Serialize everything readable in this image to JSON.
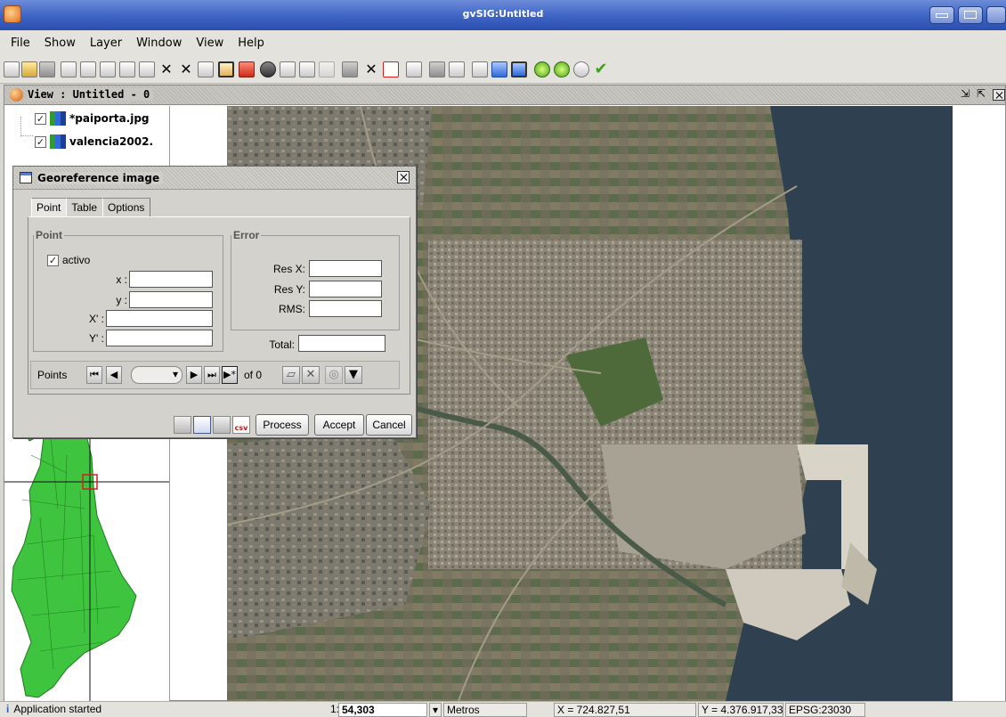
{
  "window": {
    "title": "gvSIG:Untitled"
  },
  "menu": [
    "File",
    "Show",
    "Layer",
    "Window",
    "View",
    "Help"
  ],
  "toolbar": {
    "icons": [
      "new-project-icon",
      "open-project-icon",
      "save-project-icon",
      "add-layer-icon",
      "zoom-in-icon",
      "zoom-out-icon",
      "zoom-previous-icon",
      "full-extent-icon",
      "zoom-select-icon",
      "zoom-layer-icon",
      "zoom-back-icon",
      "pan-icon",
      "select-icon",
      "info-icon",
      "measure-distance-icon",
      "measure-area-icon",
      "georef-icon",
      "table-icon",
      "clear-icon",
      "rectangle-select-icon",
      "locator-icon",
      "attribute-icon",
      "grid-icon",
      "tools-icon",
      "print-icon",
      "layout-icon",
      "green-point-icon",
      "green-circle-icon",
      "search-icon",
      "check-icon"
    ]
  },
  "view": {
    "title": "View : Untitled - 0",
    "layers": [
      {
        "name": "*paiporta.jpg",
        "checked": true
      },
      {
        "name": "valencia2002.",
        "checked": true
      }
    ]
  },
  "dialog": {
    "title": "Georeference image",
    "tabs": [
      "Point",
      "Table",
      "Options"
    ],
    "point_group": "Point",
    "active_label": "activo",
    "active_checked": true,
    "x_label": "x :",
    "y_label": "y :",
    "x_prime_label": "X' :",
    "y_prime_label": "Y' :",
    "x_value": "",
    "y_value": "",
    "x_prime_value": "",
    "y_prime_value": "",
    "error_group": "Error",
    "res_x_label": "Res X:",
    "res_y_label": "Res Y:",
    "rms_label": "RMS:",
    "total_label": "Total:",
    "res_x_value": "",
    "res_y_value": "",
    "rms_value": "",
    "total_value": "",
    "points_label": "Points",
    "of_text": "of 0",
    "csv_label": "csv",
    "process_label": "Process",
    "accept_label": "Accept",
    "cancel_label": "Cancel"
  },
  "status": {
    "message": "Application started",
    "scale_prefix": "1:",
    "scale": "54,303",
    "units": "Metros",
    "x_coord": "X = 724.827,51",
    "y_coord": "Y = 4.376.917,33",
    "epsg": "EPSG:23030"
  },
  "colors": {
    "title_bar": "#3d63c4",
    "map_green": "#2fbf2f",
    "sea": "#2f4150"
  }
}
